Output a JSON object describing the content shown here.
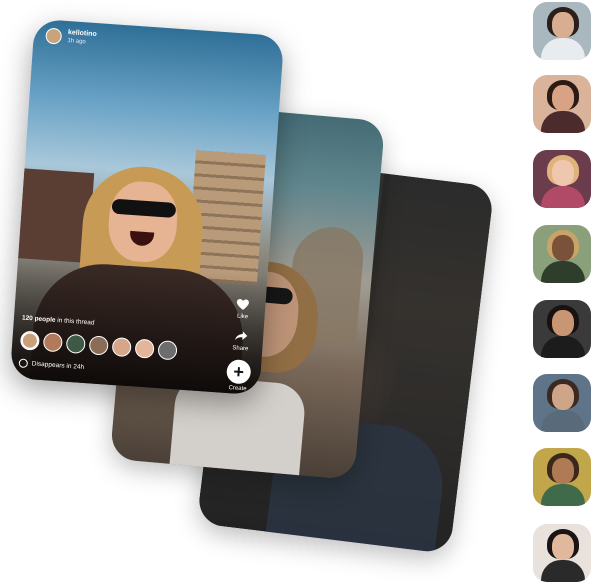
{
  "post": {
    "username": "kellotino",
    "time_ago": "1h ago",
    "actions": [
      {
        "label": "Like",
        "icon": "heart-icon"
      },
      {
        "label": "Share",
        "icon": "share-icon"
      },
      {
        "label": "Create",
        "icon": "plus-icon"
      }
    ],
    "thread_count": "120 people",
    "thread_suffix": " in this thread",
    "disappear_text": "Disappears in 24h",
    "thread_avatar_colors": [
      "#caa07c",
      "#b27a5a",
      "#3e5a47",
      "#8b6d57",
      "#d6a58a",
      "#e3b59a",
      "#6d6d6d"
    ]
  },
  "side_thumbnails": [
    {
      "name": "profile-thumb-1",
      "bg": "#a9b7bf",
      "skin": "#d8ad90",
      "hair": "#2a1f1a",
      "body": "#e9ecef"
    },
    {
      "name": "profile-thumb-2",
      "bg": "#d9b49a",
      "skin": "#d8a384",
      "hair": "#2b1b14",
      "body": "#4b2b2b"
    },
    {
      "name": "profile-thumb-3",
      "bg": "#6b3c4c",
      "skin": "#efc6ae",
      "hair": "#e0b37a",
      "body": "#b04a66"
    },
    {
      "name": "profile-thumb-4",
      "bg": "#8aa07a",
      "skin": "#7a5239",
      "hair": "#c9a36a",
      "body": "#2f3e2c"
    },
    {
      "name": "profile-thumb-5",
      "bg": "#3a3a3a",
      "skin": "#c99673",
      "hair": "#1a1210",
      "body": "#1c1c1c"
    },
    {
      "name": "profile-thumb-6",
      "bg": "#5f7488",
      "skin": "#cfa58a",
      "hair": "#3b2a22",
      "body": "#596b7a"
    },
    {
      "name": "profile-thumb-7",
      "bg": "#c2a74a",
      "skin": "#b07a55",
      "hair": "#3a281c",
      "body": "#3f6b4a"
    },
    {
      "name": "profile-thumb-8",
      "bg": "#e8e1dc",
      "skin": "#e2b89c",
      "hair": "#1a1414",
      "body": "#2a2a2a"
    }
  ]
}
